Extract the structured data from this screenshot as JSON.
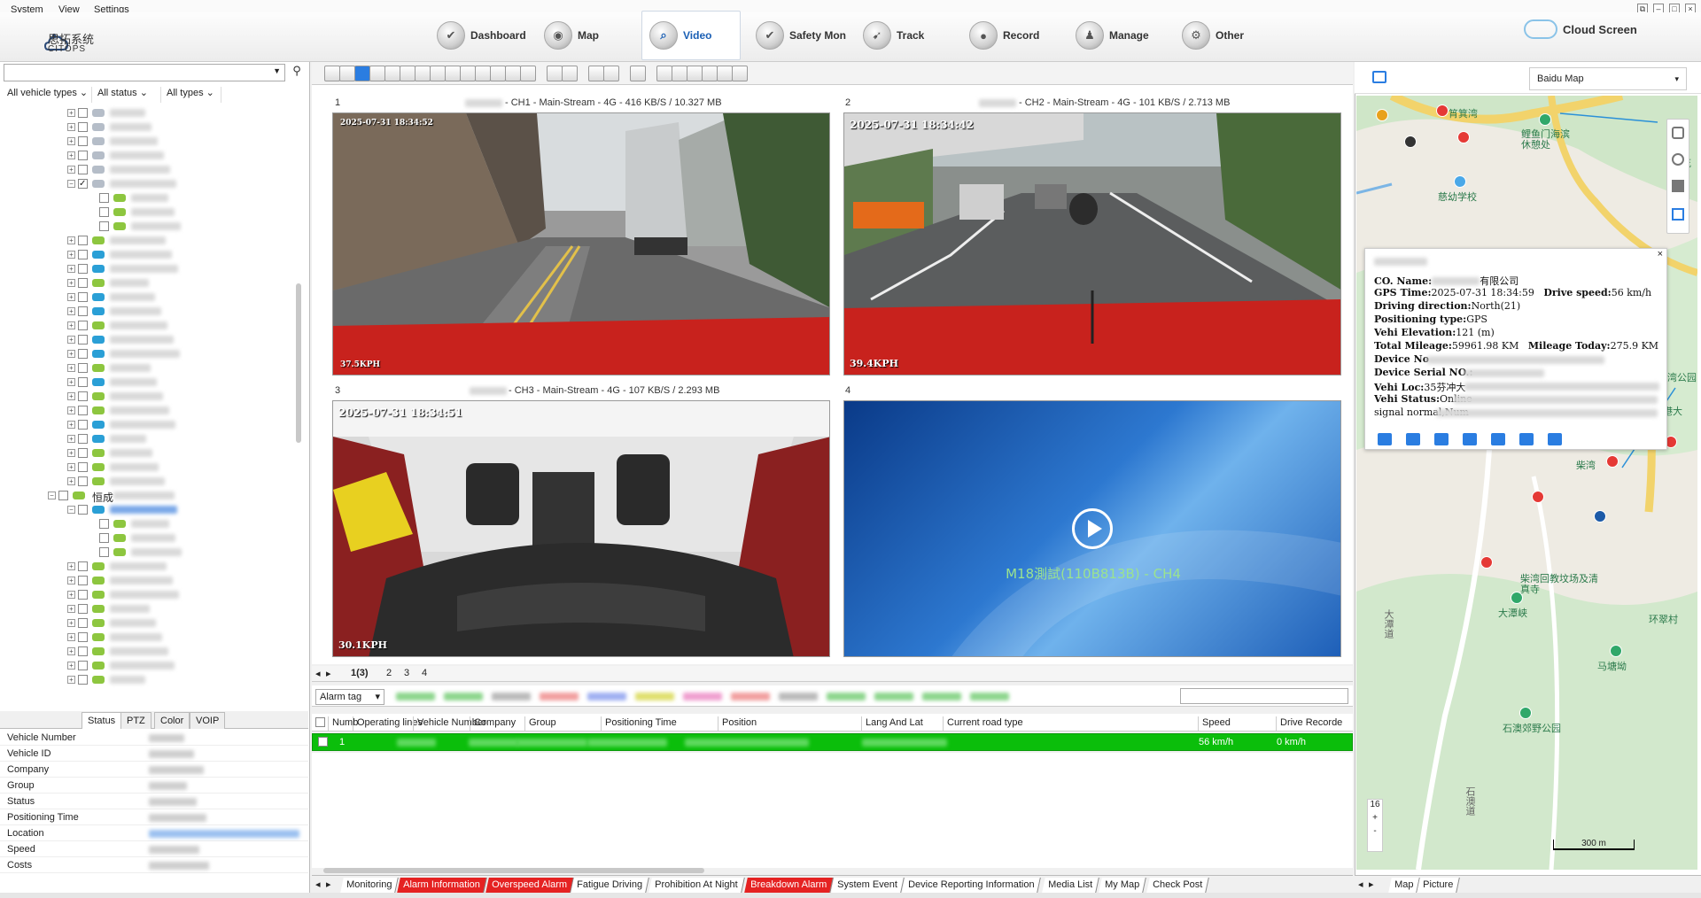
{
  "menu": {
    "items": [
      "System",
      "View",
      "Settings"
    ]
  },
  "logo": {
    "name": "思拓系统",
    "sub": "CITOPS"
  },
  "nav": {
    "items": [
      {
        "label": "Dashboard",
        "icon": "shield-check-icon"
      },
      {
        "label": "Map",
        "icon": "map-icon"
      },
      {
        "label": "Video",
        "icon": "video-icon"
      },
      {
        "label": "Safety Mon",
        "icon": "safety-shield-icon"
      },
      {
        "label": "Track",
        "icon": "track-icon"
      },
      {
        "label": "Record",
        "icon": "record-icon"
      },
      {
        "label": "Manage",
        "icon": "manage-icon"
      },
      {
        "label": "Other",
        "icon": "gear-icon"
      }
    ],
    "active": "Video",
    "cloud_label": "Cloud Screen"
  },
  "filters": {
    "vehicle_types": "All vehicle types",
    "status": "All status",
    "types": "All types"
  },
  "tree": {
    "group_label": "恒成"
  },
  "left_tabs": [
    "Status",
    "PTZ",
    "Color",
    "VOIP"
  ],
  "props": {
    "labels": [
      "Vehicle Number",
      "Vehicle ID",
      "Company",
      "Group",
      "Status",
      "Positioning Time",
      "Location",
      "Speed",
      "Costs"
    ]
  },
  "video": {
    "tiles": [
      {
        "num": "1",
        "label": "- CH1 - Main-Stream - 4G - 416 KB/S / 10.327 MB",
        "timestamp": "2025-07-31 18:34:52",
        "speed": "37.5KPH"
      },
      {
        "num": "2",
        "label": "- CH2 - Main-Stream - 4G - 101 KB/S / 2.713 MB",
        "timestamp": "2025-07-31 18:34:42",
        "speed": "39.4KPH"
      },
      {
        "num": "3",
        "label": "- CH3 - Main-Stream - 4G - 107 KB/S / 2.293 MB",
        "timestamp": "2025-07-31 18:34:51",
        "speed": "30.1KPH"
      },
      {
        "num": "4",
        "label": "",
        "placeholder": "M18測試(110B813B) - CH4"
      }
    ],
    "pages": [
      "1(3)",
      "2",
      "3",
      "4"
    ]
  },
  "alarm": {
    "tag": "Alarm tag"
  },
  "grid": {
    "headers": [
      "Numb",
      "Operating lines",
      "Vehicle Number",
      "Company",
      "Group",
      "Positioning Time",
      "Position",
      "Lang And Lat",
      "Current road type",
      "Speed",
      "Drive Recorde"
    ],
    "row": {
      "num": "1",
      "speed": "56 km/h",
      "recorder": "0 km/h"
    }
  },
  "bottom_tabs": [
    {
      "label": "Monitoring",
      "red": false
    },
    {
      "label": "Alarm Information",
      "red": true
    },
    {
      "label": "Overspeed Alarm",
      "red": true
    },
    {
      "label": "Fatigue Driving",
      "red": false
    },
    {
      "label": "Prohibition At Night",
      "red": false
    },
    {
      "label": "Breakdown Alarm",
      "red": true
    },
    {
      "label": "System Event",
      "red": false
    },
    {
      "label": "Device Reporting Information",
      "red": false
    },
    {
      "label": "Media List",
      "red": false
    },
    {
      "label": "My Map",
      "red": false
    },
    {
      "label": "Check Post",
      "red": false
    }
  ],
  "map": {
    "provider": "Baidu Map",
    "labels": [
      "筲箕湾",
      "鲤鱼门海滨休憩处",
      "慈幼学校",
      "柴湾",
      "柴湾回教坟场及清真寺",
      "大潭峡",
      "马塘坳",
      "石澳郊野公园",
      "环翠村",
      "大潭道",
      "石澳道",
      "柴湾公园",
      "港大",
      "杏花"
    ],
    "zoom": "16",
    "scale": "300 m",
    "tabs": [
      "Map",
      "Picture"
    ]
  },
  "popup": {
    "co_name_label": "CO. Name:",
    "co_name_suffix": "有限公司",
    "gps_time_label": "GPS Time:",
    "gps_time": "2025-07-31 18:34:59",
    "drive_speed_label": "Drive speed:",
    "drive_speed": "56 km/h",
    "direction_label": "Driving direction:",
    "direction": "North(21)",
    "pos_type_label": "Positioning type:",
    "pos_type": "GPS",
    "elev_label": "Vehi Elevation:",
    "elev": "121 (m)",
    "mileage_label": "Total Mileage:",
    "mileage": "59961.98 KM",
    "today_label": "Mileage Today:",
    "today": "275.9 KM",
    "device_no_label": "Device No",
    "serial_label": "Device Serial NO.:",
    "loc_label": "Vehi Loc:",
    "loc_prefix": "35芬冲大",
    "status_label": "Vehi Status:",
    "status": "Online",
    "signal": "signal normal,Num"
  }
}
